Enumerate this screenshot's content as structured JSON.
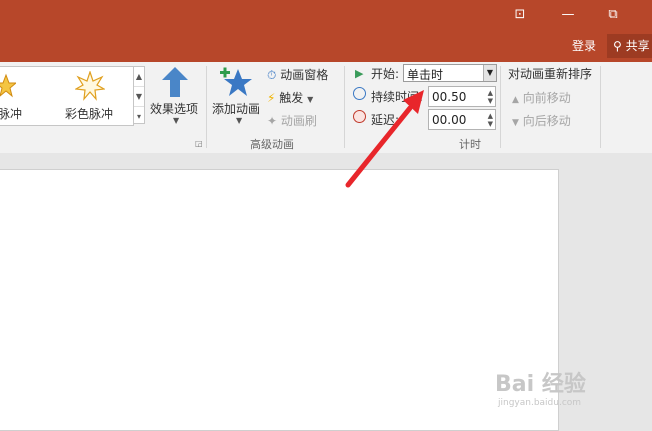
{
  "window_controls": {
    "ribbon_display": "⊡",
    "minimize": "—",
    "restore": "⧉"
  },
  "account": {
    "login": "登录",
    "share": "共享"
  },
  "animation_gallery": {
    "items": [
      {
        "label": "脉冲",
        "icon": "burst-star-icon"
      },
      {
        "label": "彩色脉冲",
        "icon": "outline-burst-star-icon"
      }
    ]
  },
  "effect_options": {
    "label": "效果选项"
  },
  "advanced_animation": {
    "add_animation": "添加动画",
    "animation_pane": "动画窗格",
    "trigger": "触发",
    "animation_painter": "动画刷",
    "group_label": "高级动画"
  },
  "timing": {
    "start_label": "开始:",
    "start_value": "单击时",
    "duration_label": "持续时间:",
    "duration_value": "00.50",
    "delay_label": "延迟:",
    "delay_value": "00.00",
    "group_label": "计时"
  },
  "reorder": {
    "title": "对动画重新排序",
    "move_earlier": "向前移动",
    "move_later": "向后移动"
  },
  "watermark": {
    "brand": "Bai 经验",
    "url": "jingyan.baidu.com"
  },
  "colors": {
    "accent": "#b7472a",
    "annotation_arrow": "#e8262b"
  }
}
